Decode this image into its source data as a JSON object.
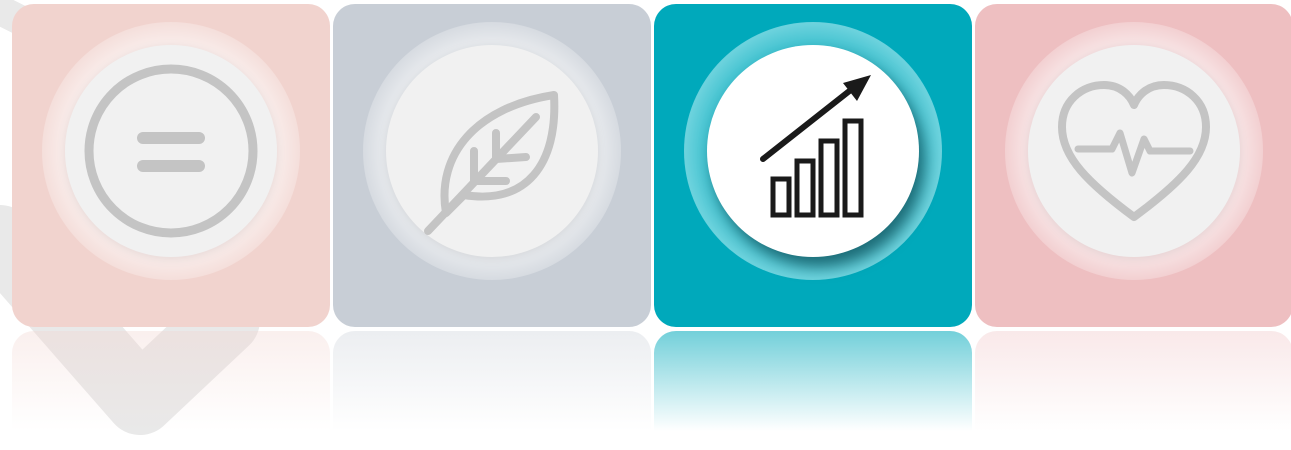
{
  "tiles": [
    {
      "icon": "equals-icon",
      "color": "#f1d3ce",
      "active": false
    },
    {
      "icon": "leaf-icon",
      "color": "#c8ced6",
      "active": false
    },
    {
      "icon": "growth-chart-icon",
      "color": "#00a9bb",
      "active": true
    },
    {
      "icon": "heart-pulse-icon",
      "color": "#eebfc1",
      "active": false
    }
  ],
  "colors": {
    "inactive_icon_stroke": "#c4c4c4",
    "active_icon_stroke": "#1a1a1a",
    "background_shape": "#e9e9e9"
  }
}
